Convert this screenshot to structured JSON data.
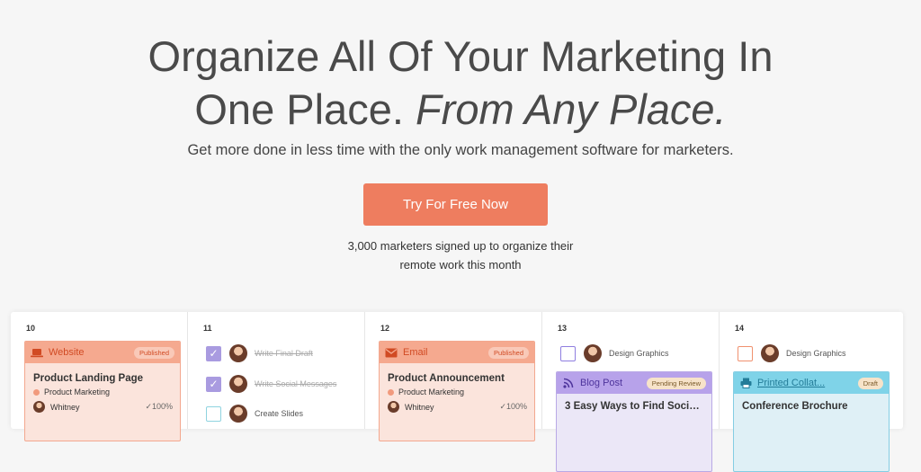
{
  "hero": {
    "headline_line1": "Organize All Of Your Marketing In",
    "headline_line2_plain": "One Place. ",
    "headline_line2_italic": "From Any Place.",
    "subtitle": "Get more done in less time with the only work management software for marketers.",
    "cta_label": "Try For Free Now",
    "signup_line1": "3,000 marketers signed up to organize their",
    "signup_line2": "remote work this month"
  },
  "calendar": {
    "columns": [
      {
        "day": "10",
        "card": {
          "type_label": "Website",
          "status": "Published",
          "title": "Product Landing Page",
          "category": "Product Marketing",
          "owner": "Whitney",
          "progress": "✓100%"
        }
      },
      {
        "day": "11",
        "tasks": [
          {
            "label": "Write Final Draft",
            "done": true
          },
          {
            "label": "Write Social Messages",
            "done": true
          },
          {
            "label": "Create Slides",
            "done": false
          }
        ]
      },
      {
        "day": "12",
        "card": {
          "type_label": "Email",
          "status": "Published",
          "title": "Product Announcement",
          "category": "Product Marketing",
          "owner": "Whitney",
          "progress": "✓100%"
        }
      },
      {
        "day": "13",
        "task": {
          "label": "Design Graphics",
          "done": false
        },
        "card": {
          "type_label": "Blog Post",
          "status": "Pending Review",
          "title": "3 Easy Ways to Find Social..."
        }
      },
      {
        "day": "14",
        "task": {
          "label": "Design Graphics",
          "done": false
        },
        "card": {
          "type_label": "Printed Collat...",
          "status": "Draft",
          "title": "Conference Brochure"
        }
      }
    ]
  },
  "colors": {
    "cta": "#ee7d5f",
    "orange_card": "#fbe4dc",
    "purple_card": "#ebe7f7",
    "blue_card": "#dff0f6"
  }
}
